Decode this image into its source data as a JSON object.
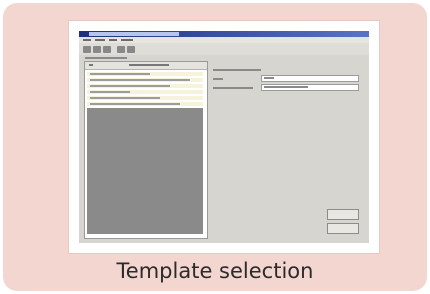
{
  "caption": "Template selection",
  "colors": {
    "card_background": "#f2d6cf",
    "titlebar": "#1f2f7e",
    "window_background": "#d7d5cf",
    "list_highlight": "#f7f2dc",
    "preview_area": "#8a8a8a"
  },
  "icons": [
    "new-icon",
    "open-icon",
    "save-icon",
    "print-icon",
    "help-icon"
  ]
}
